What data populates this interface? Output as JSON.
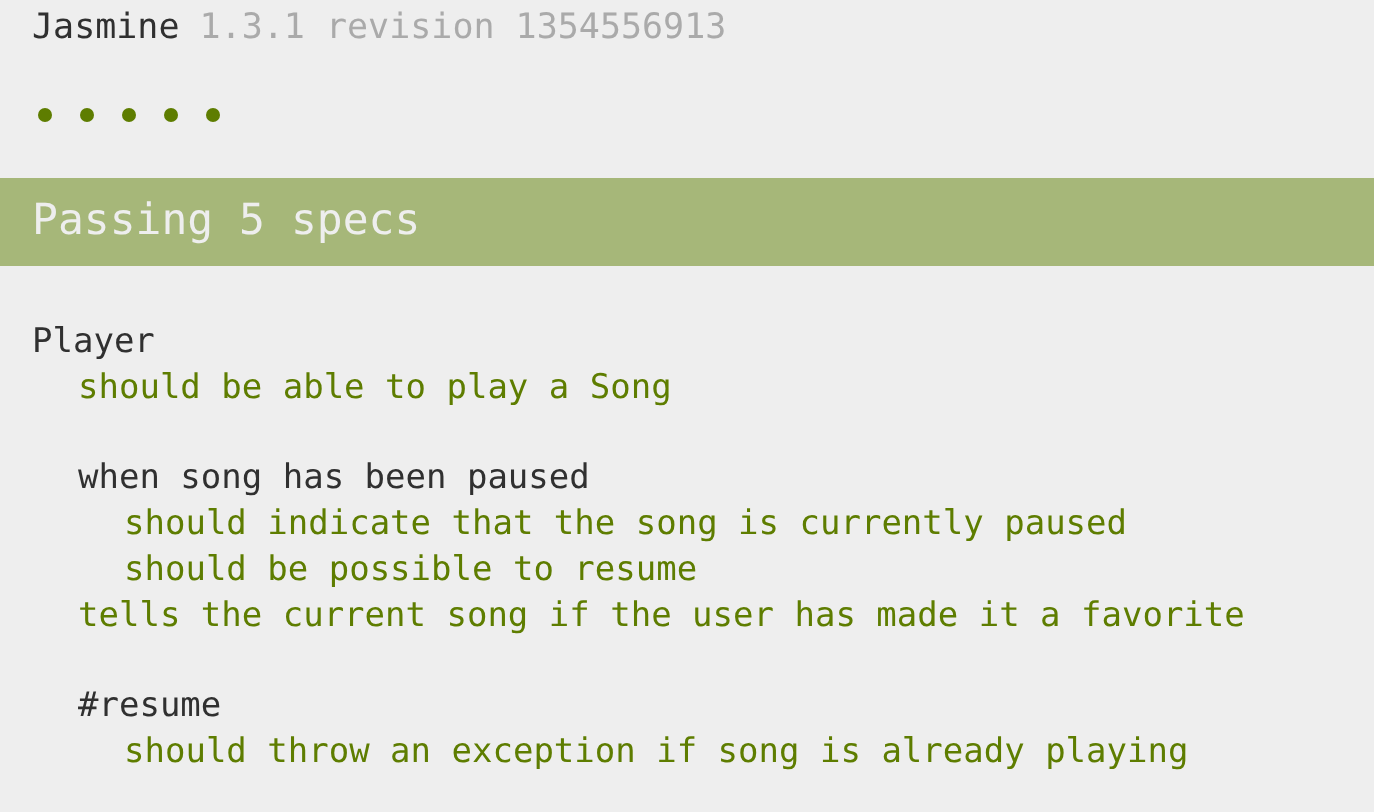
{
  "header": {
    "title": "Jasmine",
    "version": "1.3.1 revision 1354556913"
  },
  "spec_dots": [
    {
      "passed": true
    },
    {
      "passed": true
    },
    {
      "passed": true
    },
    {
      "passed": true
    },
    {
      "passed": true
    }
  ],
  "summary_bar": {
    "text": "Passing 5 specs",
    "passed": true
  },
  "results": [
    {
      "kind": "suite",
      "label": "Player",
      "children": [
        {
          "kind": "spec",
          "label": "should be able to play a Song",
          "passed": true
        },
        {
          "kind": "suite",
          "label": "when song has been paused",
          "children": [
            {
              "kind": "spec",
              "label": "should indicate that the song is currently paused",
              "passed": true
            },
            {
              "kind": "spec",
              "label": "should be possible to resume",
              "passed": true
            }
          ]
        },
        {
          "kind": "spec",
          "label": "tells the current song if the user has made it a favorite",
          "passed": true
        },
        {
          "kind": "suite",
          "label": "#resume",
          "children": [
            {
              "kind": "spec",
              "label": "should throw an exception if song is already playing",
              "passed": true
            }
          ]
        }
      ]
    }
  ]
}
